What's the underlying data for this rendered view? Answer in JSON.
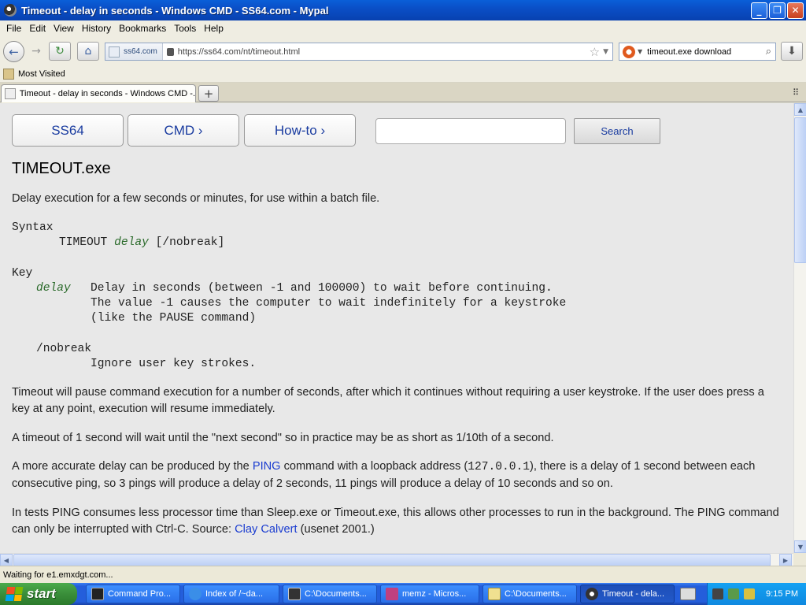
{
  "window": {
    "title": "Timeout - delay in seconds - Windows CMD - SS64.com - Mypal",
    "minimize": "_",
    "restore": "❐",
    "close": "✕"
  },
  "menu": [
    "File",
    "Edit",
    "View",
    "History",
    "Bookmarks",
    "Tools",
    "Help"
  ],
  "nav": {
    "site_badge": "ss64.com",
    "url": "https://ss64.com/nt/timeout.html",
    "search_query": "timeout.exe download"
  },
  "bookmarks": {
    "most_visited": "Most Visited"
  },
  "tab": {
    "label": "Timeout - delay in seconds - Windows CMD -..."
  },
  "page": {
    "nav_buttons": [
      "SS64",
      "CMD ›",
      "How-to ›"
    ],
    "search_button": "Search",
    "title": "TIMEOUT.exe",
    "intro": "Delay execution for a few seconds or minutes, for use within a batch file.",
    "syntax_label": "Syntax",
    "syntax_cmd": "TIMEOUT",
    "syntax_arg": "delay",
    "syntax_opt": "[/nobreak]",
    "key_label": "Key",
    "key_delay": "delay",
    "key_delay_desc1": "Delay in seconds (between -1 and 100000) to wait before continuing.",
    "key_delay_desc2": "The value -1 causes the computer to wait indefinitely for a keystroke",
    "key_delay_desc3": "(like the PAUSE command)",
    "key_nobreak": "/nobreak",
    "key_nobreak_desc": "Ignore user key strokes.",
    "para1": "Timeout will pause command execution for a number of seconds, after which it continues without requiring a user keystroke. If the user does press a key at any point, execution will resume immediately.",
    "para2": "A timeout of 1 second will wait until the \"next second\" so in practice may be as short as 1/10th of a second.",
    "para3_a": "A more accurate delay can be produced by the ",
    "para3_link": "PING",
    "para3_b": " command with a loopback address (",
    "para3_code": "127.0.0.1",
    "para3_c": "), there is a delay of 1 second between each consecutive ping, so 3 pings will produce a delay of 2 seconds, 11 pings will produce a delay of 10 seconds and so on.",
    "para4_a": "In tests PING consumes less processor time than Sleep.exe or Timeout.exe, this allows other processes to run in the background. The PING command can only be interrupted with Ctrl-C. Source: ",
    "para4_link": "Clay Calvert",
    "para4_b": " (usenet 2001.)"
  },
  "status": "Waiting for e1.emxdgt.com...",
  "taskbar": {
    "start": "start",
    "tasks": [
      "Command Pro...",
      "Index of /~da...",
      "C:\\Documents...",
      "memz - Micros...",
      "C:\\Documents...",
      "Timeout - dela..."
    ],
    "clock": "9:15 PM"
  },
  "colors": {
    "accent": "#245EDB",
    "link": "#1a3cd0",
    "page_bg": "#E8E8E8"
  }
}
